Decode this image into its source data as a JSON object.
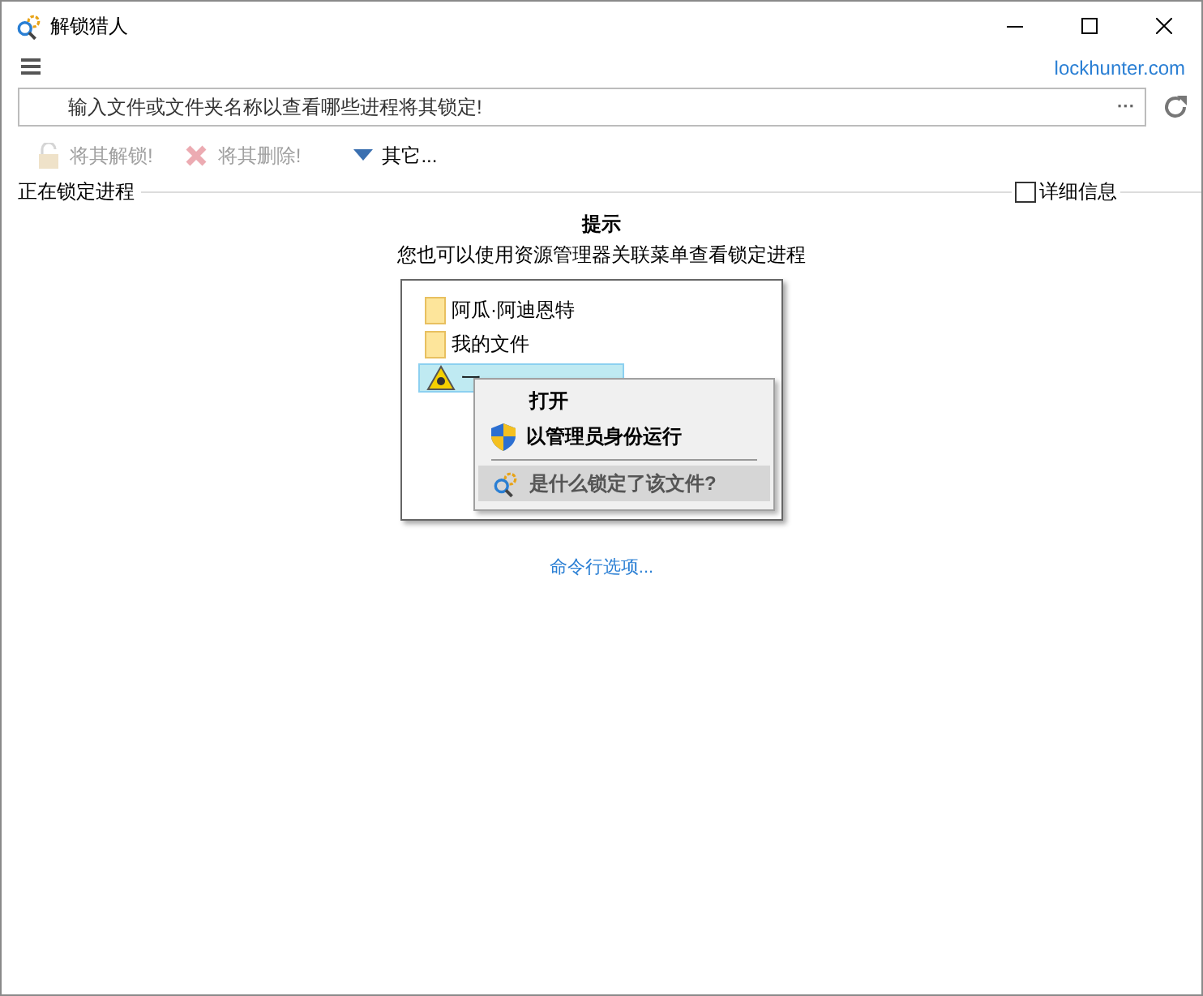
{
  "window": {
    "title": "解锁猎人"
  },
  "header": {
    "link": "lockhunter.com"
  },
  "search": {
    "placeholder": "输入文件或文件夹名称以查看哪些进程将其锁定!",
    "browse": "···"
  },
  "toolbar": [
    {
      "kind": "unlock",
      "label": "将其解锁!",
      "disabled": true
    },
    {
      "kind": "delete",
      "label": "将其删除!",
      "disabled": true
    },
    {
      "kind": "dropdown",
      "label": "其它...",
      "disabled": false
    }
  ],
  "group": {
    "title": "正在锁定进程",
    "details": {
      "label": "详细信息",
      "checked": false
    }
  },
  "hint": {
    "title": "提示",
    "text": "您也可以使用资源管理器关联菜单查看锁定进程"
  },
  "illustration": {
    "files": [
      {
        "kind": "folder",
        "name": "阿瓜·阿迪恩特",
        "selected": false
      },
      {
        "kind": "folder",
        "name": "我的文件",
        "selected": false
      },
      {
        "kind": "hazard",
        "name": "一",
        "selected": true
      }
    ],
    "menu": [
      {
        "kind": "plain",
        "label": "打开",
        "highlighted": false
      },
      {
        "kind": "shield",
        "label": "以管理员身份运行",
        "highlighted": false
      },
      {
        "kind": "lockhunter",
        "label": "是什么锁定了该文件?",
        "highlighted": true
      }
    ]
  },
  "command_line_link": "命令行选项..."
}
